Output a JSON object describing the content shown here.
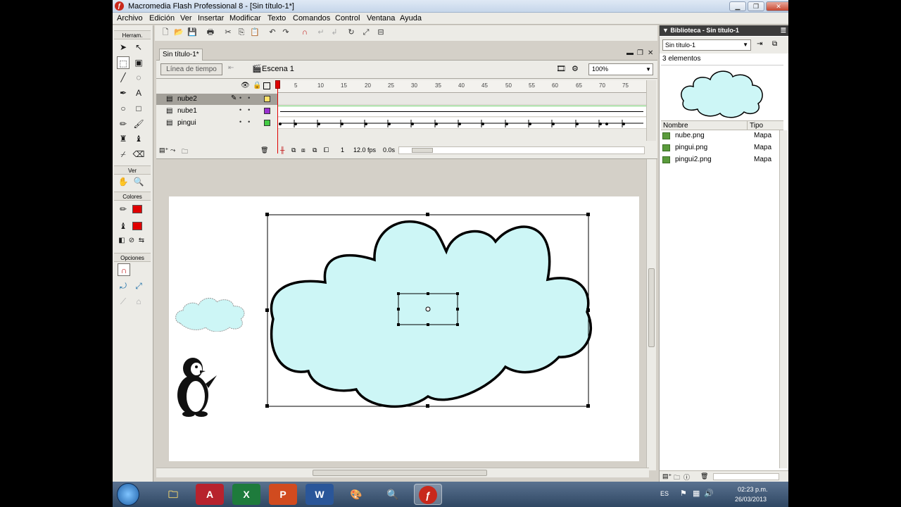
{
  "window": {
    "title": "Macromedia Flash Professional 8 - [Sin título-1*]",
    "minimize_icon": "minimize-icon",
    "maximize_icon": "restore-icon",
    "close_icon": "close-icon"
  },
  "menu": [
    "Archivo",
    "Edición",
    "Ver",
    "Insertar",
    "Modificar",
    "Texto",
    "Comandos",
    "Control",
    "Ventana",
    "Ayuda"
  ],
  "tools_panel": {
    "header": "Herram.",
    "ver_label": "Ver",
    "colores_label": "Colores",
    "opciones_label": "Opciones",
    "stroke_color": "#e00000",
    "fill_color": "#e00000"
  },
  "document": {
    "tab_label": "Sin título-1*",
    "timeline_button": "Línea de tiempo",
    "scene_label": "Escena 1",
    "zoom": "100%"
  },
  "timeline": {
    "frame_numbers": [
      "5",
      "10",
      "15",
      "20",
      "25",
      "30",
      "35",
      "40",
      "45",
      "50",
      "55",
      "60",
      "65",
      "70",
      "75"
    ],
    "layers": [
      {
        "name": "nube2",
        "color": "#ffe066",
        "selected": true
      },
      {
        "name": "nube1",
        "color": "#9b30d0",
        "selected": false
      },
      {
        "name": "pingui",
        "color": "#44cc44",
        "selected": false
      }
    ],
    "current_frame": "1",
    "fps": "12.0 fps",
    "time": "0.0s"
  },
  "library": {
    "header": "Biblioteca - Sin título-1",
    "document_select": "Sin título-1",
    "count": "3 elementos",
    "col_name": "Nombre",
    "col_type": "Tipo",
    "items": [
      {
        "name": "nube.png",
        "type": "Mapa"
      },
      {
        "name": "pingui.png",
        "type": "Mapa"
      },
      {
        "name": "pingui2.png",
        "type": "Mapa"
      }
    ]
  },
  "taskbar": {
    "language": "ES",
    "time": "02:23 p.m.",
    "date": "26/03/2013",
    "apps": [
      "windows-explorer-icon",
      "access-icon",
      "excel-icon",
      "powerpoint-icon",
      "word-icon",
      "paint-icon",
      "search-icon",
      "flash-icon"
    ]
  },
  "colors": {
    "cloud_fill": "#cdf6f6",
    "accent_red": "#e00000"
  }
}
